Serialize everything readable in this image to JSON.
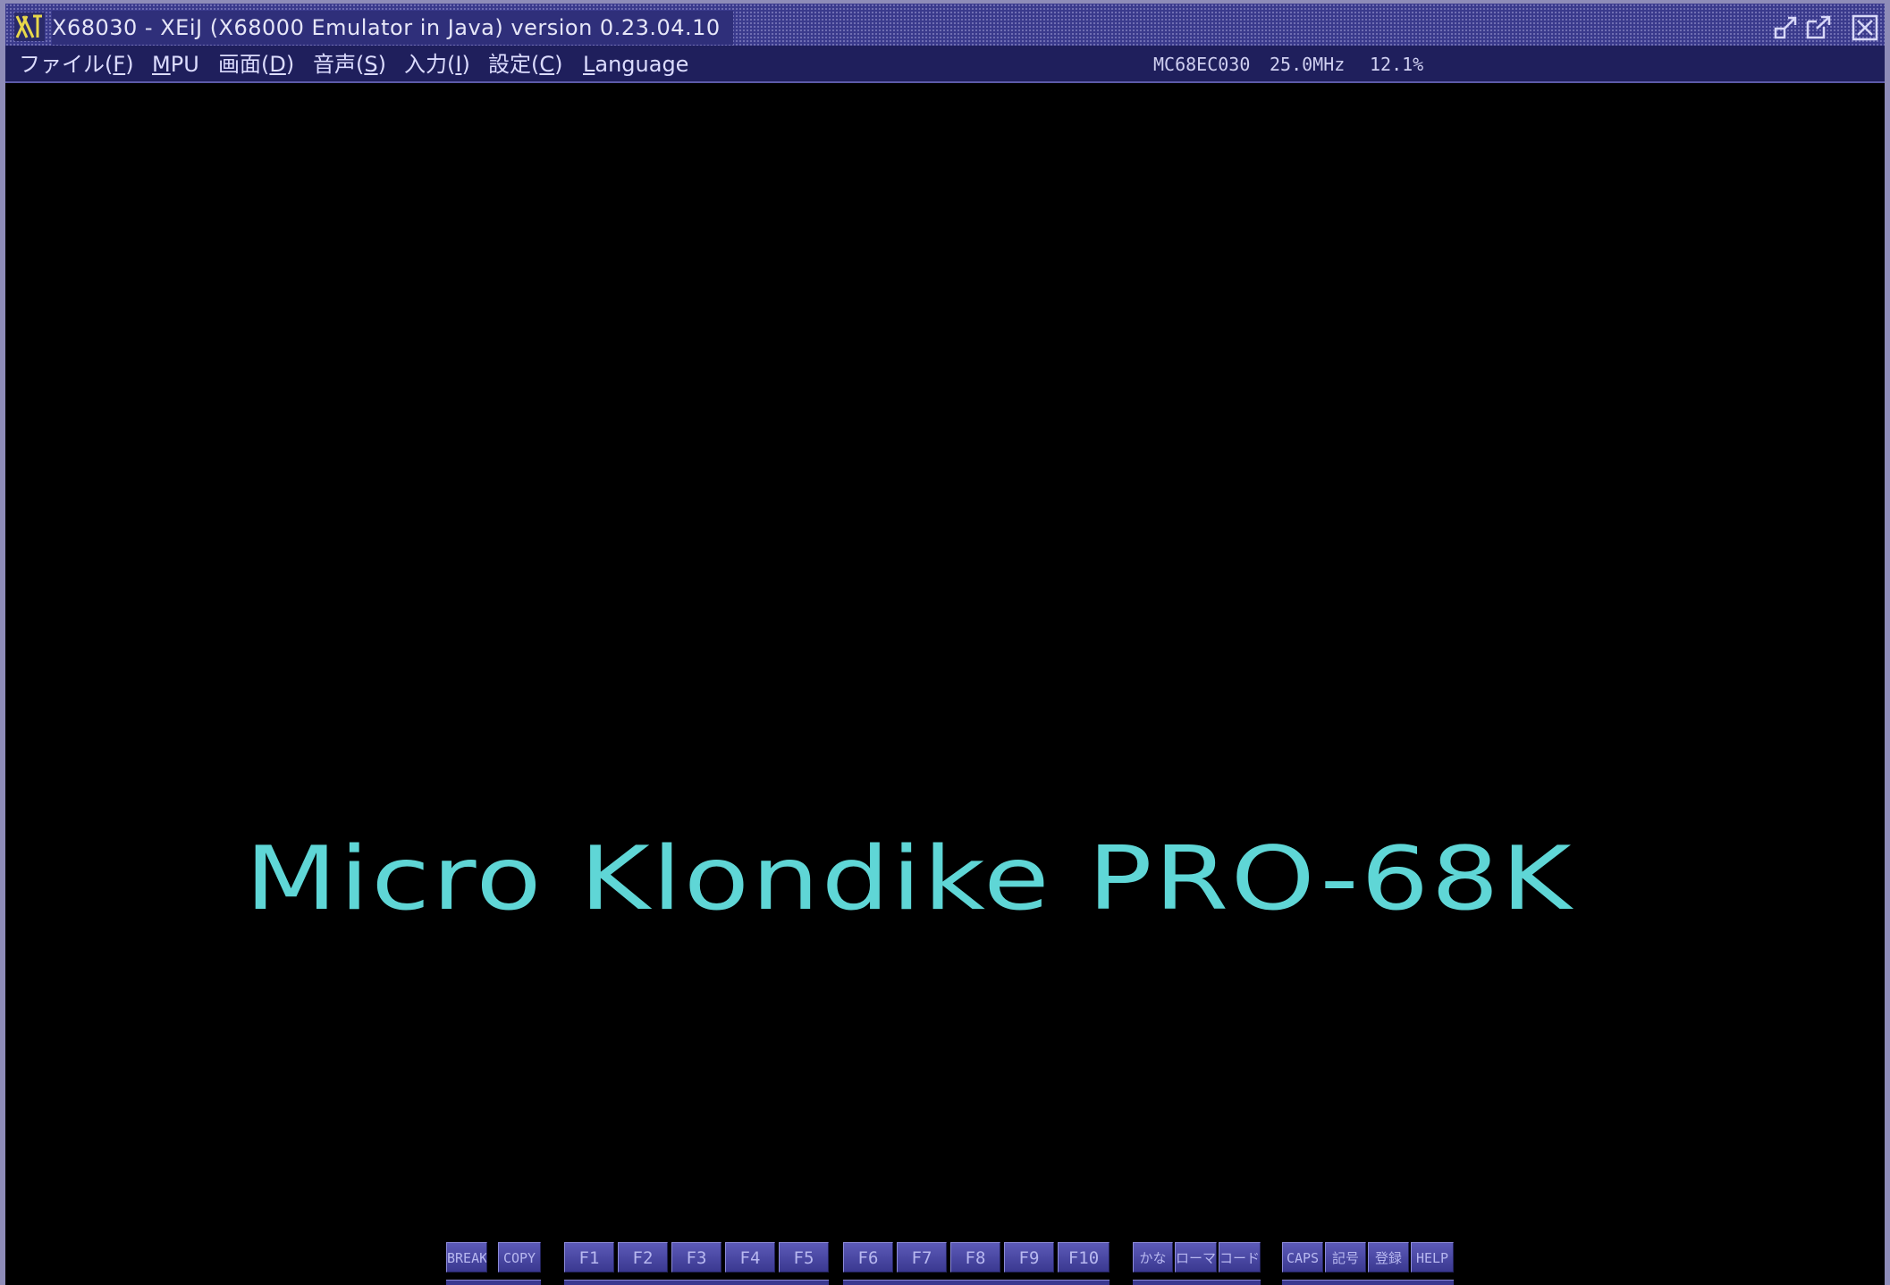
{
  "window": {
    "title": "X68030 - XEiJ (X68000 Emulator in Java) version 0.23.04.10",
    "colors": {
      "titlebar": "#3a3a8c",
      "menubar": "#1f1f5c",
      "screen": "#000000",
      "splash_text": "#5fd6d6"
    }
  },
  "icons": {
    "app": "app-logo-icon",
    "minimize": "minimize-icon",
    "maximize": "maximize-icon",
    "close": "close-icon"
  },
  "menu": {
    "file": {
      "label": "ファイル(",
      "mnemonic": "F",
      "suffix": ")"
    },
    "mpu": {
      "label": "",
      "mnemonic": "M",
      "suffix": "PU"
    },
    "screen": {
      "label": "画面(",
      "mnemonic": "D",
      "suffix": ")"
    },
    "sound": {
      "label": "音声(",
      "mnemonic": "S",
      "suffix": ")"
    },
    "input": {
      "label": "入力(",
      "mnemonic": "I",
      "suffix": ")"
    },
    "settings": {
      "label": "設定(",
      "mnemonic": "C",
      "suffix": ")"
    },
    "language": {
      "label": "",
      "mnemonic": "L",
      "suffix": "anguage"
    }
  },
  "status": {
    "cpu": "MC68EC030",
    "clock": "25.0MHz",
    "load": "12.1%"
  },
  "screen": {
    "splash_text": "Micro Klondike PRO-68K"
  },
  "keyboard": {
    "break": "BREAK",
    "copy": "COPY",
    "f1": "F1",
    "f2": "F2",
    "f3": "F3",
    "f4": "F4",
    "f5": "F5",
    "f6": "F6",
    "f7": "F7",
    "f8": "F8",
    "f9": "F9",
    "f10": "F10",
    "kana": "かな",
    "romaji": "ローマ",
    "code": "コード",
    "caps": "CAPS",
    "kigou": "記号",
    "touroku": "登録",
    "help": "HELP"
  }
}
